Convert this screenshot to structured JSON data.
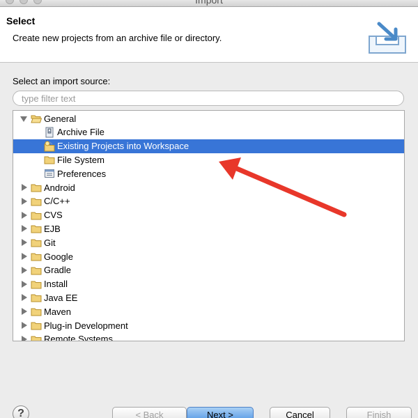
{
  "window": {
    "title": "Import"
  },
  "header": {
    "title": "Select",
    "description": "Create new projects from an archive file or directory."
  },
  "source_label": "Select an import source:",
  "filter": {
    "placeholder": "type filter text",
    "value": ""
  },
  "tree": {
    "items": [
      {
        "label": "General",
        "state": "expanded",
        "level": 0,
        "icon": "folder-open-icon"
      },
      {
        "label": "Archive File",
        "state": "leaf",
        "level": 1,
        "icon": "archive-file-icon"
      },
      {
        "label": "Existing Projects into Workspace",
        "state": "leaf",
        "level": 1,
        "icon": "existing-projects-icon",
        "selected": true
      },
      {
        "label": "File System",
        "state": "leaf",
        "level": 1,
        "icon": "folder-icon"
      },
      {
        "label": "Preferences",
        "state": "leaf",
        "level": 1,
        "icon": "preferences-icon"
      },
      {
        "label": "Android",
        "state": "collapsed",
        "level": 0,
        "icon": "folder-icon"
      },
      {
        "label": "C/C++",
        "state": "collapsed",
        "level": 0,
        "icon": "folder-icon"
      },
      {
        "label": "CVS",
        "state": "collapsed",
        "level": 0,
        "icon": "folder-icon"
      },
      {
        "label": "EJB",
        "state": "collapsed",
        "level": 0,
        "icon": "folder-icon"
      },
      {
        "label": "Git",
        "state": "collapsed",
        "level": 0,
        "icon": "folder-icon"
      },
      {
        "label": "Google",
        "state": "collapsed",
        "level": 0,
        "icon": "folder-icon"
      },
      {
        "label": "Gradle",
        "state": "collapsed",
        "level": 0,
        "icon": "folder-icon"
      },
      {
        "label": "Install",
        "state": "collapsed",
        "level": 0,
        "icon": "folder-icon"
      },
      {
        "label": "Java EE",
        "state": "collapsed",
        "level": 0,
        "icon": "folder-icon"
      },
      {
        "label": "Maven",
        "state": "collapsed",
        "level": 0,
        "icon": "folder-icon"
      },
      {
        "label": "Plug-in Development",
        "state": "collapsed",
        "level": 0,
        "icon": "folder-icon"
      },
      {
        "label": "Remote Systems",
        "state": "collapsed",
        "level": 0,
        "icon": "folder-icon"
      }
    ]
  },
  "buttons": {
    "help": "?",
    "back": "< Back",
    "next": "Next >",
    "cancel": "Cancel",
    "finish": "Finish"
  },
  "colors": {
    "selection": "#3875d7",
    "annotation_arrow": "#e8372a"
  }
}
